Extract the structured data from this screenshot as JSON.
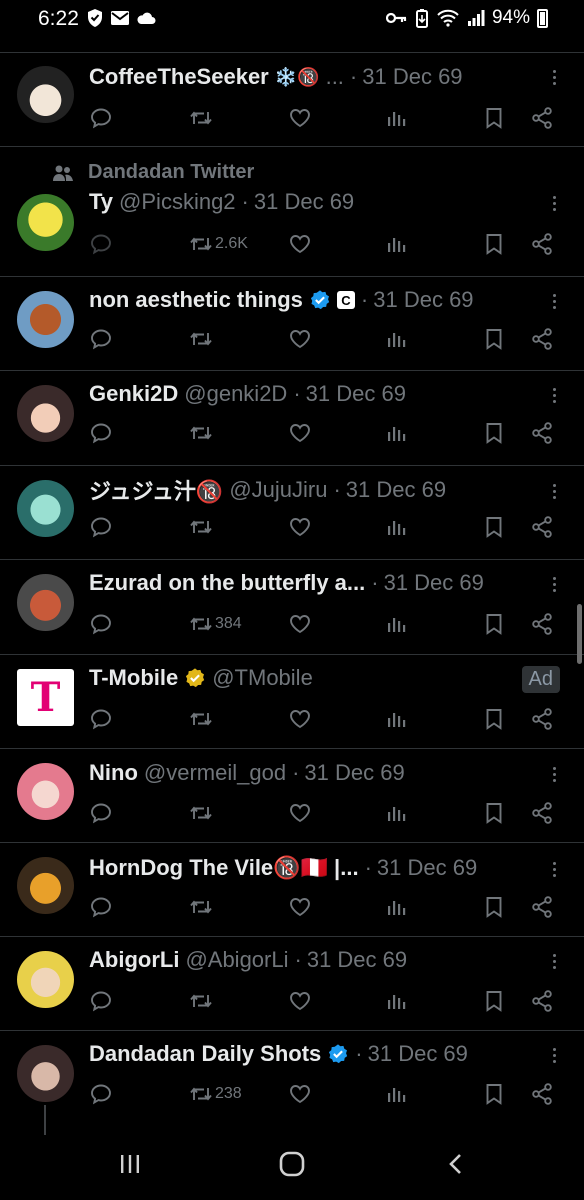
{
  "status_bar": {
    "time": "6:22",
    "battery": "94%",
    "icons": [
      "shield-icon",
      "mail-icon",
      "cloud-icon",
      "key-icon",
      "battery-saver-icon",
      "wifi-icon",
      "signal-icon",
      "battery-icon"
    ]
  },
  "social_context": "Dandadan Twitter",
  "tweets": [
    {
      "name": "CoffeeTheSeeker",
      "badge": "❄️🔞",
      "handle": "...",
      "sep": "·",
      "date": "31 Dec 69",
      "retweets": "",
      "avatar": "avatar-coffeetheseeker"
    },
    {
      "name": "Ty",
      "handle": "@Picsking2",
      "sep": "·",
      "date": "31 Dec 69",
      "retweets": "2.6K",
      "avatar": "avatar-ty"
    },
    {
      "name": "non aesthetic things",
      "badge": "verified-icon",
      "handle": "",
      "sep": "·",
      "date": "31 Dec 69",
      "retweets": "",
      "avatar": "avatar-non-aesthetic-things"
    },
    {
      "name": "Genki2D",
      "handle": "@genki2D",
      "sep": "·",
      "date": "31 Dec 69",
      "retweets": "",
      "avatar": "avatar-genki2d"
    },
    {
      "name": "ジュジュ汁🔞",
      "handle": "@JujuJiru",
      "sep": "·",
      "date": "31 Dec 69",
      "retweets": "",
      "avatar": "avatar-jujujiru"
    },
    {
      "name": "Ezurad on the butterfly a...",
      "handle": "",
      "sep": "·",
      "date": "31 Dec 69",
      "retweets": "384",
      "avatar": "avatar-ezurad"
    },
    {
      "name": "T-Mobile",
      "badge": "gold-verified-icon",
      "handle": "@TMobile",
      "ad": "Ad",
      "retweets": "",
      "avatar": "avatar-tmobile",
      "logo_letter": "T"
    },
    {
      "name": "Nino",
      "handle": "@vermeil_god",
      "sep": "·",
      "date": "31 Dec 69",
      "retweets": "",
      "avatar": "avatar-nino"
    },
    {
      "name": "HornDog The Vile🔞🇵🇪 |...",
      "handle": "",
      "sep": "·",
      "date": "31 Dec 69",
      "retweets": "",
      "avatar": "avatar-horndog"
    },
    {
      "name": "AbigorLi",
      "handle": "@AbigorLi",
      "sep": "·",
      "date": "31 Dec 69",
      "retweets": "",
      "avatar": "avatar-abigorli"
    },
    {
      "name": "Dandadan Daily Shots",
      "badge": "verified-icon",
      "handle": "",
      "sep": "·",
      "date": "31 Dec 69",
      "retweets": "238",
      "avatar": "avatar-dandadan-daily"
    }
  ],
  "colors": {
    "background": "#000000",
    "text": "#e7e9ea",
    "muted": "#71767b",
    "verified": "#1d9bf0",
    "gold": "#e2b719",
    "tmobile": "#e20074"
  },
  "nav_bar": [
    "recents-icon",
    "home-icon",
    "back-icon"
  ]
}
